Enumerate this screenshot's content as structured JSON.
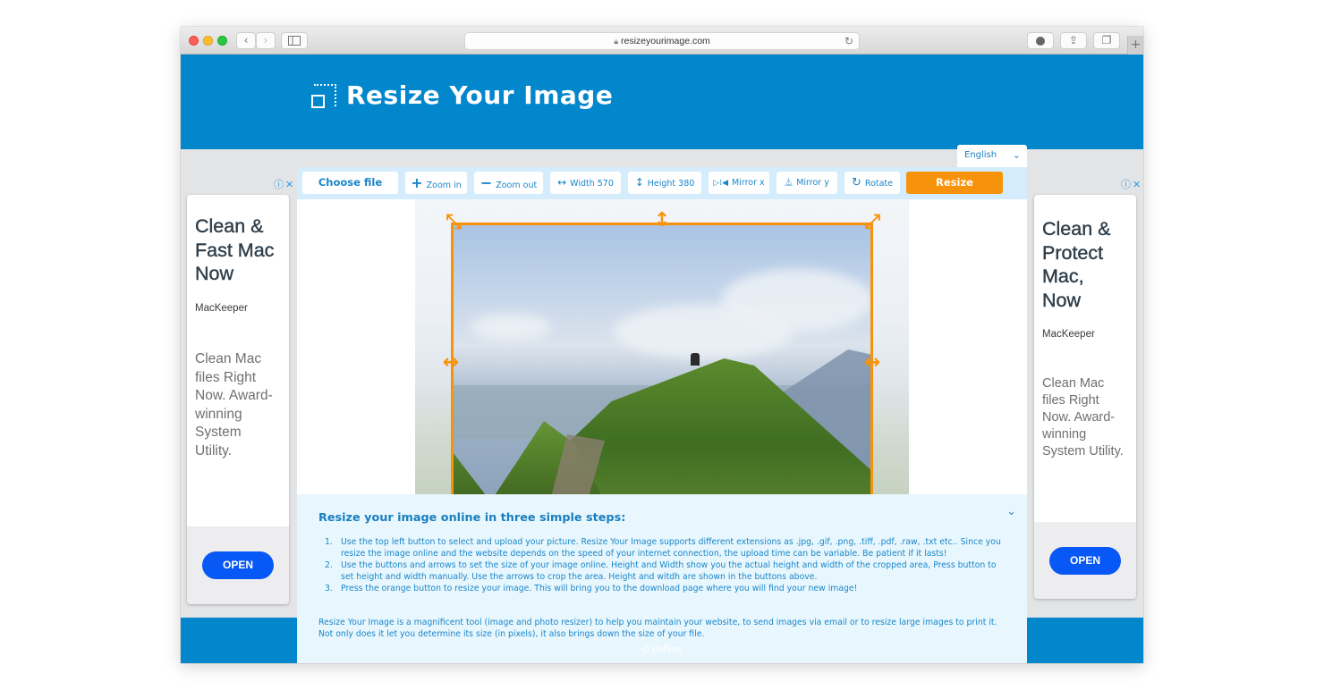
{
  "browser": {
    "url": "resizeyourimage.com",
    "back_icon": "‹",
    "forward_icon": "›",
    "reload_icon": "↻",
    "download_icon": "●",
    "share_icon": "⇪",
    "tabs_icon": "❐",
    "new_tab_icon": "+"
  },
  "header": {
    "title": "Resize Your Image",
    "language": "English"
  },
  "toolbar": {
    "choose_file": "Choose file",
    "zoom_in": "Zoom in",
    "zoom_out": "Zoom out",
    "width": "Width 570",
    "height": "Height 380",
    "mirror_x": "Mirror x",
    "mirror_y": "Mirror y",
    "rotate": "Rotate",
    "resize": "Resize"
  },
  "editor": {
    "crop_width": 570,
    "crop_height": 380
  },
  "info": {
    "title": "Resize your image online in three simple steps:",
    "steps": [
      "Use the top left button to select and upload your picture. Resize Your Image supports different extensions as .jpg, .gif, .png, .tiff, .pdf, .raw, .txt etc.. Since you resize the image online and the website depends on the speed of your internet connection, the upload time can be variable. Be patient if it lasts!",
      "Use the buttons and arrows to set the size of your image online. Height and Width show you the actual height and width of the cropped area, Press button to set height and width manually. Use the arrows to crop the area. Height and witdh are shown in the buttons above.",
      "Press the orange button to resize your image. This will bring you to the download page where you will find your new image!"
    ],
    "about": "Resize Your Image is a magnificent tool (image and photo resizer) to help you maintain your website, to send images via email or to resize large images to print it. Not only does it let you determine its size (in pixels), it also brings down the size of your file."
  },
  "ads": {
    "left": {
      "headline_lines": [
        "Clean &",
        "Fast Mac",
        "Now"
      ],
      "brand": "MacKeeper",
      "desc_lines": [
        "Clean Mac",
        "files Right",
        "Now. Award-",
        "winning",
        "System",
        "Utility."
      ],
      "cta": "OPEN"
    },
    "right": {
      "headline_lines": [
        "Clean &",
        "Protect",
        "Mac,",
        "Now"
      ],
      "brand": "MacKeeper",
      "desc_lines": [
        "Clean Mac",
        "files Right",
        "Now. Award-",
        "winning",
        "System Utility."
      ],
      "cta": "OPEN"
    },
    "choices_label": "ⓘ✕"
  },
  "footer": {
    "copyright": "© deNes"
  },
  "colors": {
    "brand_blue": "#0286cc",
    "accent_orange": "#f7930a",
    "toolbar_bg": "#d4ecfb",
    "info_bg": "#e8f7fe",
    "ad_cta": "#0858f5"
  }
}
